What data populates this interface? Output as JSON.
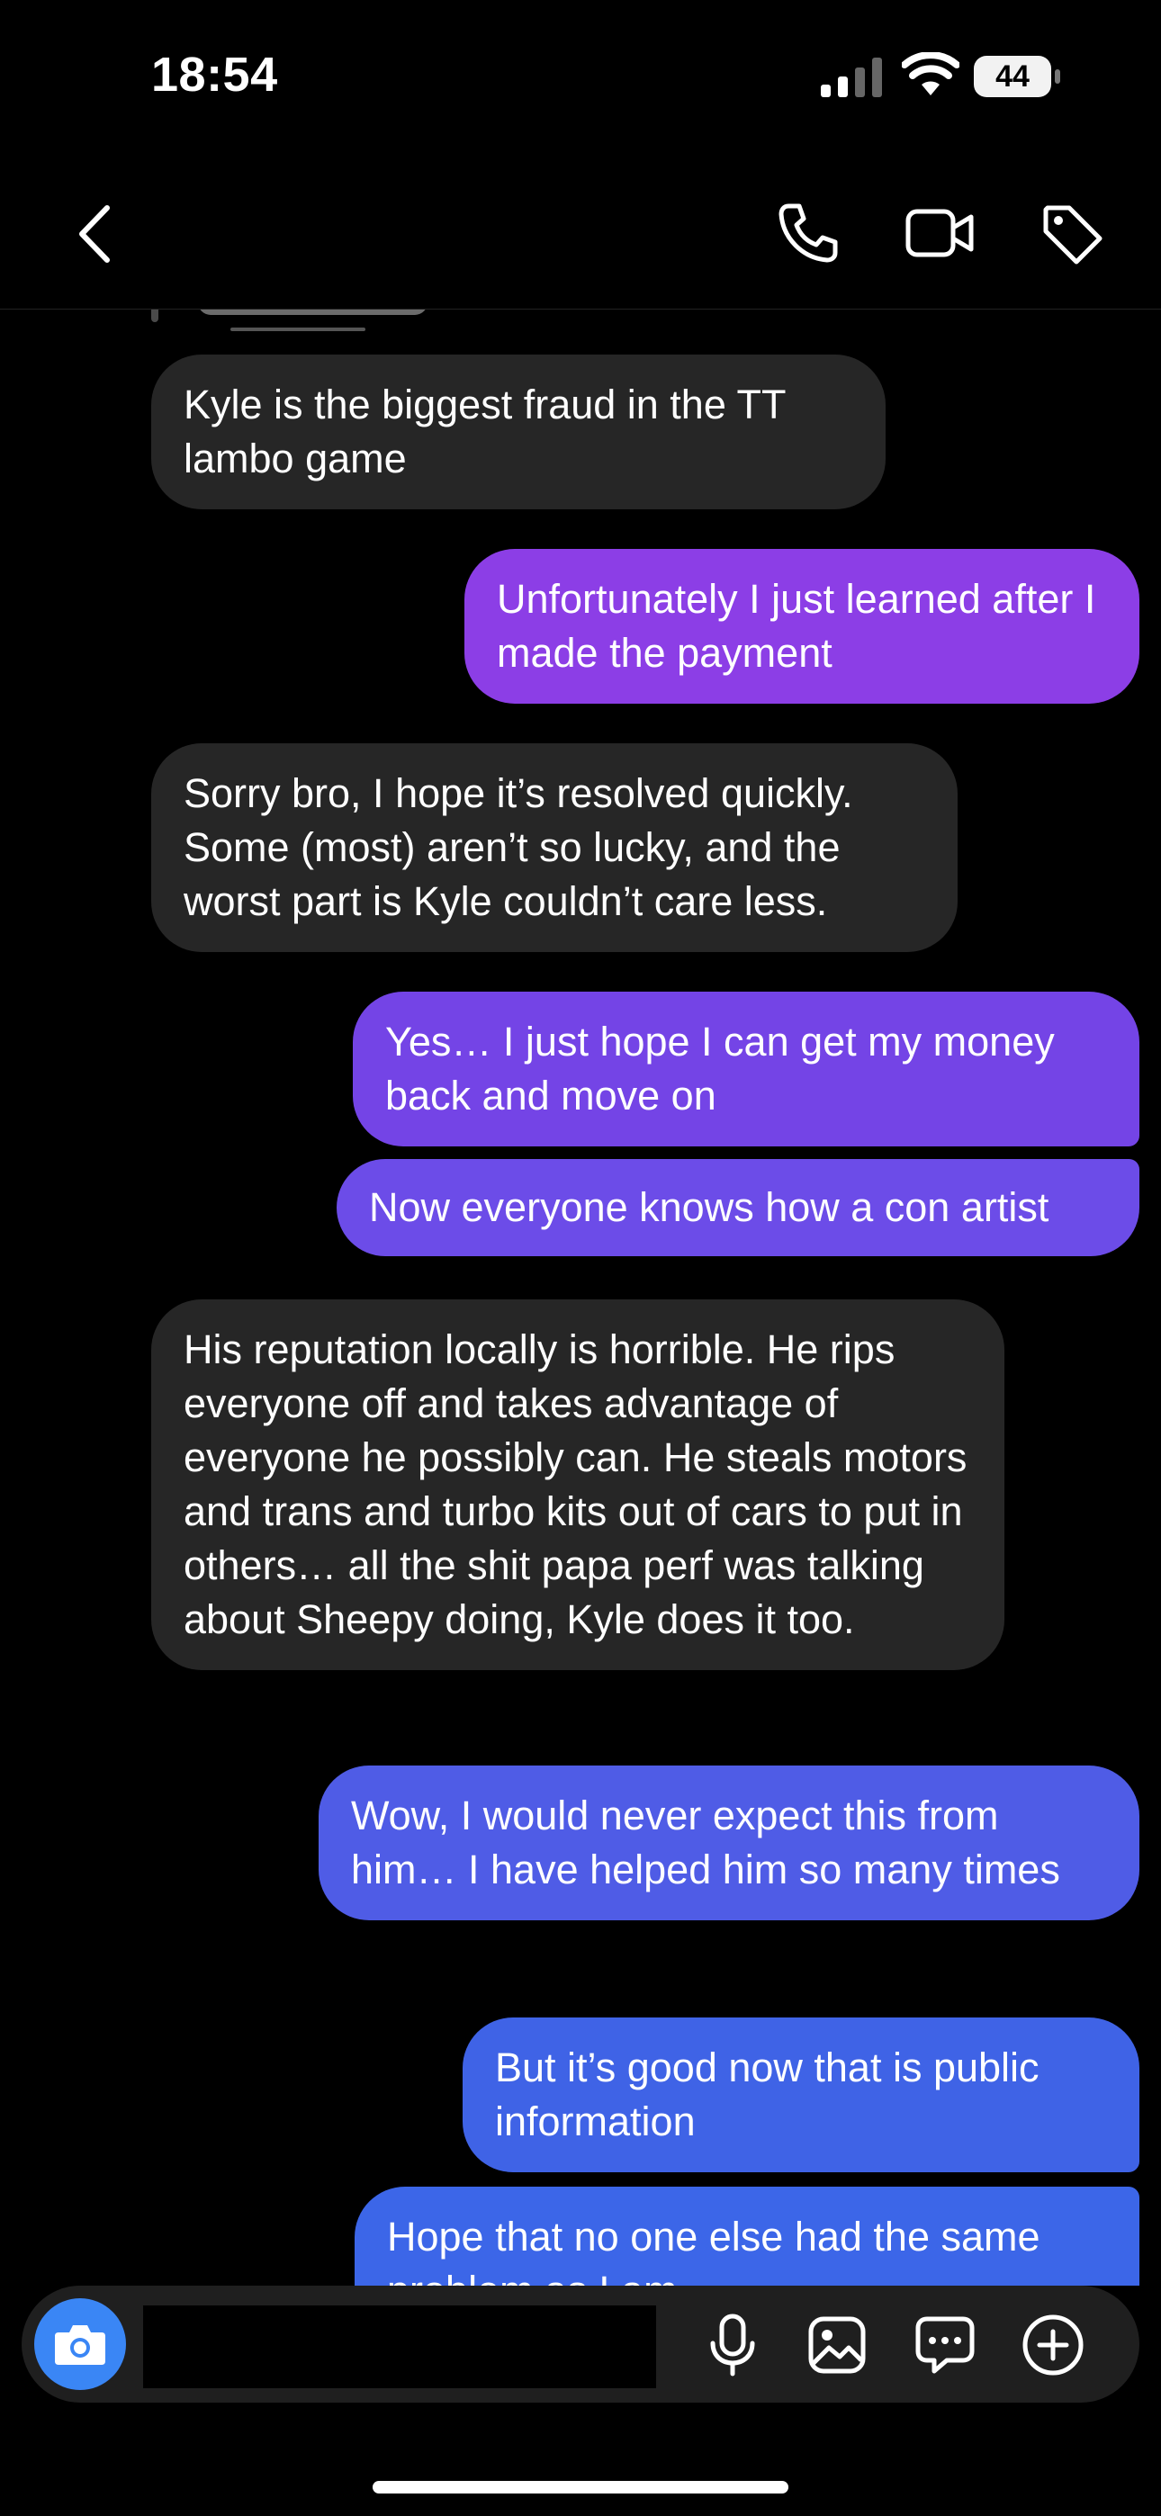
{
  "status_bar": {
    "time": "18:54",
    "battery": "44"
  },
  "nav": {
    "icons": [
      "chevron-left-icon",
      "phone-icon",
      "video-camera-icon",
      "tag-icon"
    ]
  },
  "messages": [
    {
      "side": "incoming",
      "text": "Kyle is the biggest fraud in the TT lambo game"
    },
    {
      "side": "outgoing",
      "text": "Unfortunately I just learned after I made the payment"
    },
    {
      "side": "incoming",
      "text": "Sorry bro, I hope it’s resolved quickly. Some (most) aren’t so lucky, and the worst part is Kyle couldn’t care less."
    },
    {
      "side": "outgoing",
      "text": "Yes… I just hope I can get my money back and move on"
    },
    {
      "side": "outgoing",
      "text": "Now everyone knows how a con artist"
    },
    {
      "side": "incoming",
      "text": "His reputation locally is horrible. He rips everyone off and takes advantage of everyone he possibly can. He steals motors and trans and turbo kits out of cars to put in others… all the shit papa perf was talking about Sheepy doing, Kyle does it too."
    },
    {
      "side": "outgoing",
      "text": "Wow, I would never expect this from him… I have helped him so many times"
    },
    {
      "side": "outgoing",
      "text": "But it’s good now that is public information"
    },
    {
      "side": "outgoing",
      "text": "Hope that no one else had the same problem as I am"
    }
  ],
  "composer": {
    "placeholder": "",
    "icons": [
      "camera-icon",
      "microphone-icon",
      "gallery-icon",
      "sticker-icon",
      "plus-circle-icon"
    ]
  },
  "colors": {
    "incoming_bubble": "#262626",
    "outgoing_top": "#8c3ee6",
    "outgoing_bottom": "#3c66e8",
    "camera_button": "#3a86f5"
  }
}
